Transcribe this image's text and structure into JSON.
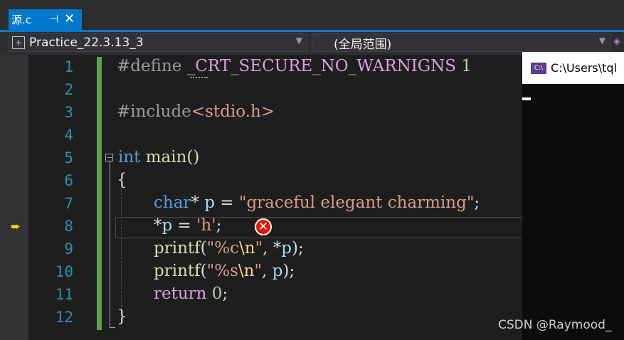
{
  "tab": {
    "title": "源.c",
    "pin": "⊣",
    "close": "✕"
  },
  "nav": {
    "project": "Practice_22.3.13_3",
    "scope": "(全局范围)"
  },
  "line_numbers": [
    "1",
    "2",
    "3",
    "4",
    "5",
    "6",
    "7",
    "8",
    "9",
    "10",
    "11",
    "12"
  ],
  "code": {
    "l1_define": "#define ",
    "l1_macro": "_CRT_SECURE_NO_WARNIGNS",
    "l1_value": " 1",
    "l3_include": "#include",
    "l3_header": "<stdio.h>",
    "l5_int": "int",
    "l5_main": " main()",
    "l6": "{",
    "l7_char": "char",
    "l7_star": "* ",
    "l7_p": "p",
    "l7_eq": " = ",
    "l7_str": "\"graceful elegant charming\"",
    "l7_semi": ";",
    "l8_star": "*",
    "l8_p": "p",
    "l8_eq": " = ",
    "l8_chr": "'h'",
    "l8_semi": ";",
    "l9_printf": "printf",
    "l9_open": "(",
    "l9_str1": "\"%c",
    "l9_esc": "\\n",
    "l9_str2": "\"",
    "l9_mid": ", *",
    "l9_p": "p",
    "l9_end": ");",
    "l10_printf": "printf",
    "l10_open": "(",
    "l10_str1": "\"%s",
    "l10_esc": "\\n",
    "l10_str2": "\"",
    "l10_mid": ", ",
    "l10_p": "p",
    "l10_end": ");",
    "l11_return": "return",
    "l11_val": " 0",
    "l11_semi": ";",
    "l12": "}"
  },
  "console": {
    "title": "C:\\Users\\tql"
  },
  "watermark": "CSDN @Raymood_",
  "icons": [
    "pin-icon",
    "close-icon",
    "project-icon",
    "dropdown-arrow-icon",
    "execution-arrow-icon",
    "error-icon",
    "console-icon"
  ]
}
